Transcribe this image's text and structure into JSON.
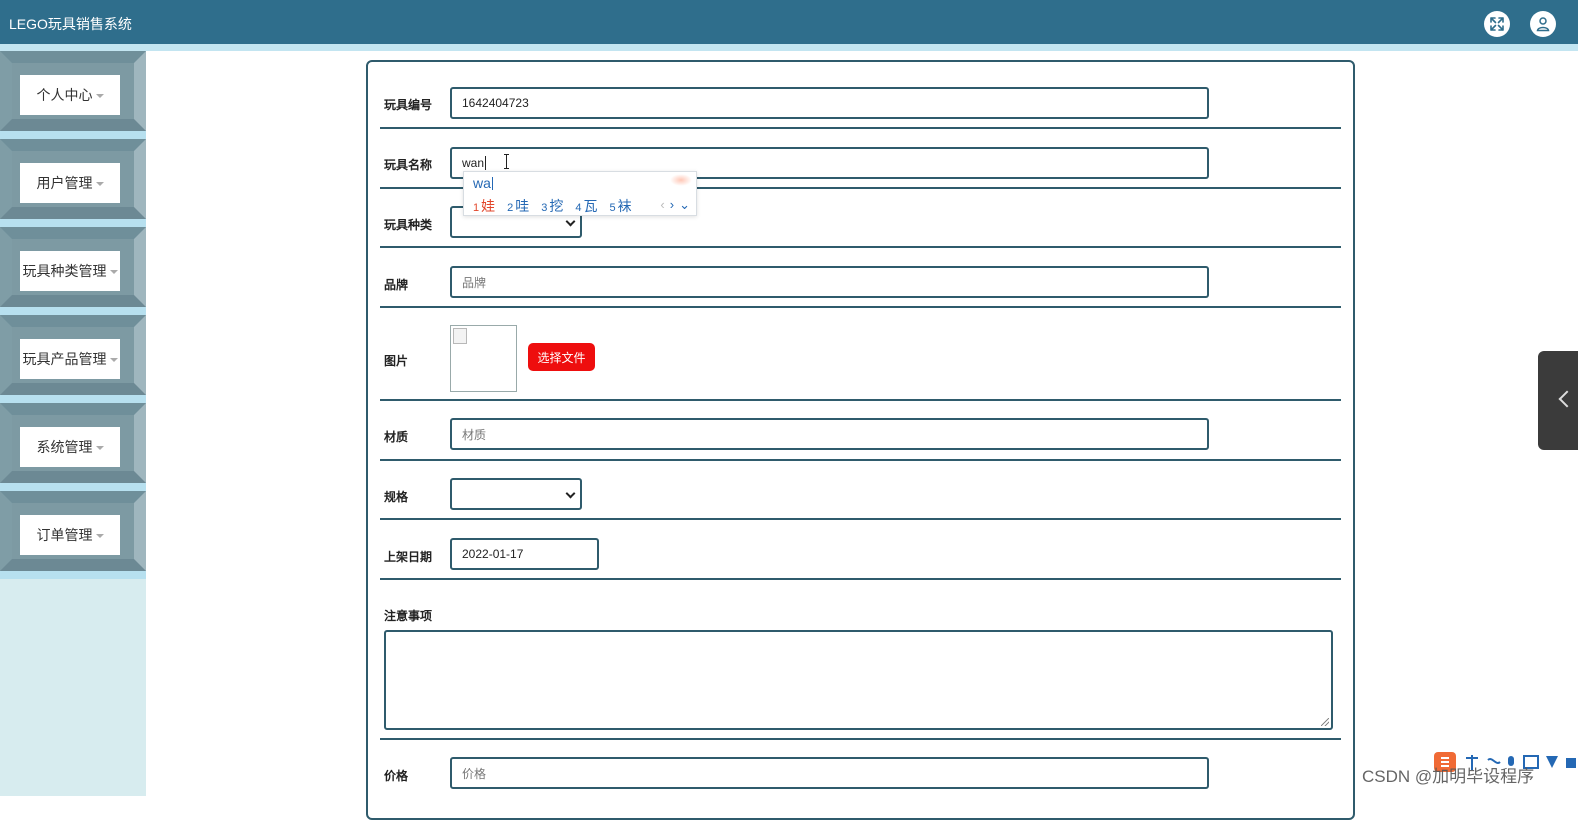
{
  "app": {
    "title": "LEGO玩具销售系统"
  },
  "header_icons": [
    "fullscreen-icon",
    "user-icon"
  ],
  "sidebar": {
    "items": [
      {
        "label": "个人中心"
      },
      {
        "label": "用户管理"
      },
      {
        "label": "玩具种类管理"
      },
      {
        "label": "玩具产品管理"
      },
      {
        "label": "系统管理"
      },
      {
        "label": "订单管理"
      }
    ]
  },
  "form": {
    "toy_no": {
      "label": "玩具编号",
      "value": "1642404723"
    },
    "toy_name": {
      "label": "玩具名称",
      "value": "wan"
    },
    "toy_type": {
      "label": "玩具种类",
      "value": ""
    },
    "brand": {
      "label": "品牌",
      "placeholder": "品牌"
    },
    "image": {
      "label": "图片",
      "button": "选择文件"
    },
    "material": {
      "label": "材质",
      "placeholder": "材质"
    },
    "spec": {
      "label": "规格",
      "value": ""
    },
    "release_date": {
      "label": "上架日期",
      "value": "2022-01-17"
    },
    "notes": {
      "label": "注意事项",
      "value": ""
    },
    "price": {
      "label": "价格",
      "placeholder": "价格"
    }
  },
  "ime": {
    "composition": "wa",
    "candidates": [
      {
        "num": "1",
        "text": "娃"
      },
      {
        "num": "2",
        "text": "哇"
      },
      {
        "num": "3",
        "text": "挖"
      },
      {
        "num": "4",
        "text": "瓦"
      },
      {
        "num": "5",
        "text": "袜"
      }
    ],
    "nav": {
      "prev": "‹",
      "next": "›",
      "expand": "⌄"
    }
  },
  "watermark": "CSDN @加明毕设程序",
  "colors": {
    "header": "#2f6e8c",
    "border": "#2f5b6c",
    "file_button": "#ee0e0e",
    "sidebar": "#b7e0ef"
  }
}
